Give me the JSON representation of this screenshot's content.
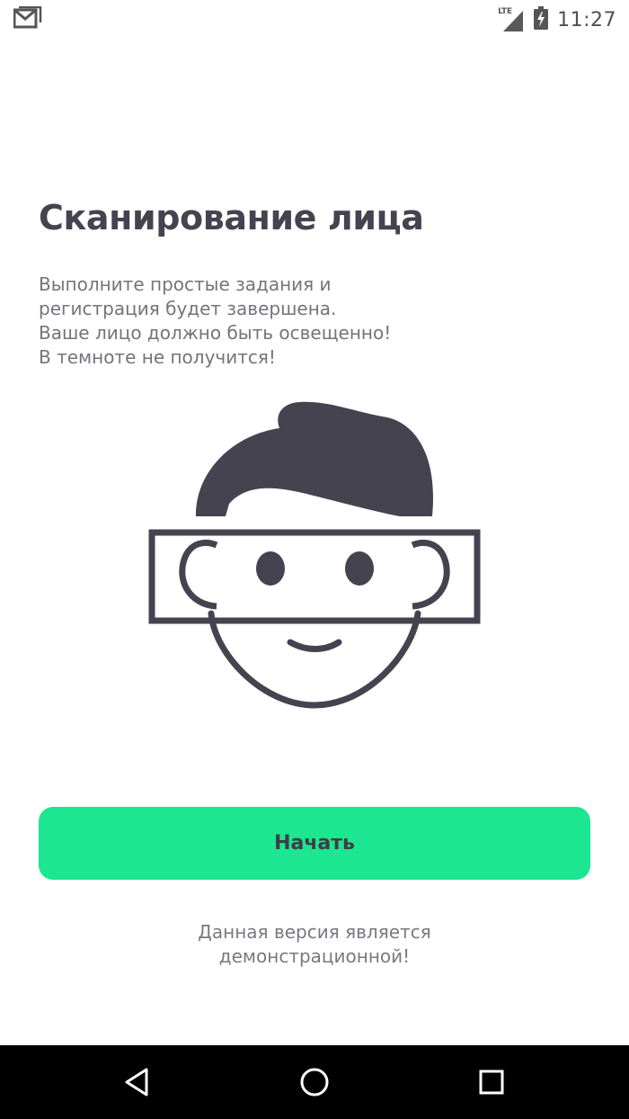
{
  "status_bar": {
    "network_label": "LTE",
    "time": "11:27",
    "icons": [
      "gmail-notification-icon",
      "signal-icon",
      "battery-charging-icon"
    ]
  },
  "main": {
    "title": "Сканирование лица",
    "description_lines": [
      "Выполните простые задания и",
      "регистрация будет завершена.",
      "Ваше лицо должно быть освещенно!",
      "В темноте не получится!"
    ],
    "illustration_icon": "face-scan-icon",
    "start_button_label": "Начать",
    "demo_note_lines": [
      "Данная версия является",
      "демонстрационной!"
    ]
  },
  "navigation": {
    "icons": [
      "back-icon",
      "home-icon",
      "recents-icon"
    ]
  },
  "colors": {
    "accent": "#1ce68f",
    "title_text": "#45434f",
    "body_text": "#75737b",
    "illustration": "#45434f",
    "nav_bar": "#000000"
  }
}
